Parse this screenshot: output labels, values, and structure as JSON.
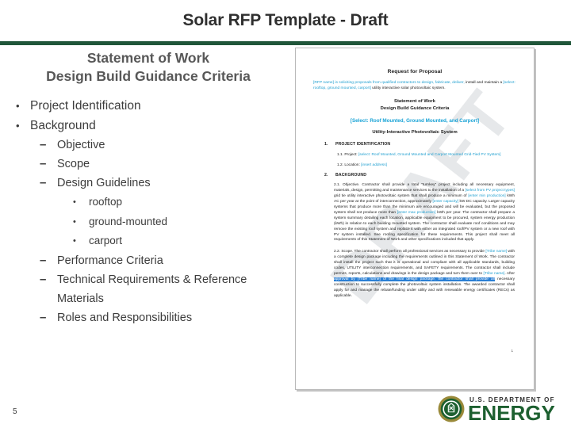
{
  "slide": {
    "title": "Solar RFP Template - Draft",
    "page_number": "5",
    "accent_green": "#20563A"
  },
  "content": {
    "heading_line1": "Statement of Work",
    "heading_line2": "Design Build Guidance Criteria",
    "outline": [
      {
        "level": 1,
        "marker": "•",
        "text": "Project Identification"
      },
      {
        "level": 1,
        "marker": "•",
        "text": "Background"
      },
      {
        "level": 2,
        "marker": "–",
        "text": "Objective"
      },
      {
        "level": 2,
        "marker": "–",
        "text": "Scope"
      },
      {
        "level": 2,
        "marker": "–",
        "text": "Design Guidelines"
      },
      {
        "level": 3,
        "marker": "•",
        "text": "rooftop"
      },
      {
        "level": 3,
        "marker": "•",
        "text": "ground-mounted"
      },
      {
        "level": 3,
        "marker": "•",
        "text": "carport"
      },
      {
        "level": 2,
        "marker": "–",
        "text": "Performance Criteria"
      },
      {
        "level": 2,
        "marker": "–",
        "text": "Technical Requirements & Reference Materials"
      },
      {
        "level": 2,
        "marker": "–",
        "text": "Roles and Responsibilities"
      }
    ]
  },
  "document": {
    "watermark": "DRAFT",
    "accent_blue": "#19A3D6",
    "highlight_blue": "#2A7FD4",
    "title": "Request for Proposal",
    "intro_a": "[RFP name] is soliciting proposals from qualified contractors to design, fabricate, deliver, ",
    "intro_b": "install and maintain a ",
    "intro_blue": "[select: rooftop, ground mounted, carport]",
    "intro_c": " utility interactive solar photovoltaic system.",
    "sub_line1": "Statement of Work",
    "sub_line2": "Design Build Guidance Criteria",
    "select_line": "[Select: Roof Mounted, Ground Mounted, and Carport]",
    "system_line": "Utility-Interactive Photovoltaic System",
    "section1_num": "1.",
    "section1_title": "PROJECT IDENTIFICATION",
    "item_1_1_label": "1.1. Project: ",
    "item_1_1_blue": "[select: Roof Mounted, Ground Mounted and Carport Mounted Grid-Tied PV System]",
    "item_1_2_label": "1.2. Location: ",
    "item_1_2_blue": "[insert address]",
    "section2_num": "2.",
    "section2_title": "BACKGROUND",
    "obj_a": "2.1. Objective. Contractor shall provide a total “turnkey” project including all necessary equipment, materials, design, permitting and maintenance services to the installation of a ",
    "obj_blue1": "[select from PV project types]",
    "obj_b": " grid tie utility interactive photovoltaic system that shall produce a minimum of ",
    "obj_blue2": "[enter min production]",
    "obj_c": " kWh AC per year at the point of interconnection, approximately ",
    "obj_blue3": "[enter capacity]",
    "obj_d": " kW DC capacity. Larger capacity systems that produce more than the minimum are encouraged and will be evaluated, but the proposed system shall not produce more than ",
    "obj_blue4": "[enter max production]",
    "obj_e": " kWh per year. The contractor shall prepare a system summary detailing each location, applicable equipment to be procured, system energy production (kWh) in relation to each building mounted system. The contractor shall evaluate roof conditions and may remove the existing roof system and replace it with either an integrated roof/PV system or a new roof with PV system installed. See roofing specification for these requirements. This project shall meet all requirements of this Statement of Work and other specifications included that apply.",
    "scope_a": "2.2. Scope. The contractor shall perform all professional services as necessary to provide ",
    "scope_blue1": "[Tribe name]",
    "scope_b": " with a complete design package including the requirements outlined in this Statement of Work. The contractor shall install the project such that it is operational and compliant with all applicable standards, building codes, UTILITY interconnection requirements, and SAFETY requirements. The contractor shall include permits, reports, calculations and drawings in the design package and turn them over to ",
    "scope_blue2": "[Tribe name]",
    "scope_c": ". After ",
    "scope_hl": "approval by [Tribe name] of the final design package, the contractor shall provide all",
    "scope_d": " necessary construction to successfully complete the photovoltaic system installation. The awarded contractor shall apply for and manage the rebate/funding under utility and with renewable energy certificates (RECs) as applicable.",
    "doc_page_number": "1"
  },
  "doe_logo": {
    "department_text": "U.S. DEPARTMENT OF",
    "energy_text": "ENERGY",
    "green": "#1D6030",
    "gold": "#9A8A3A"
  }
}
